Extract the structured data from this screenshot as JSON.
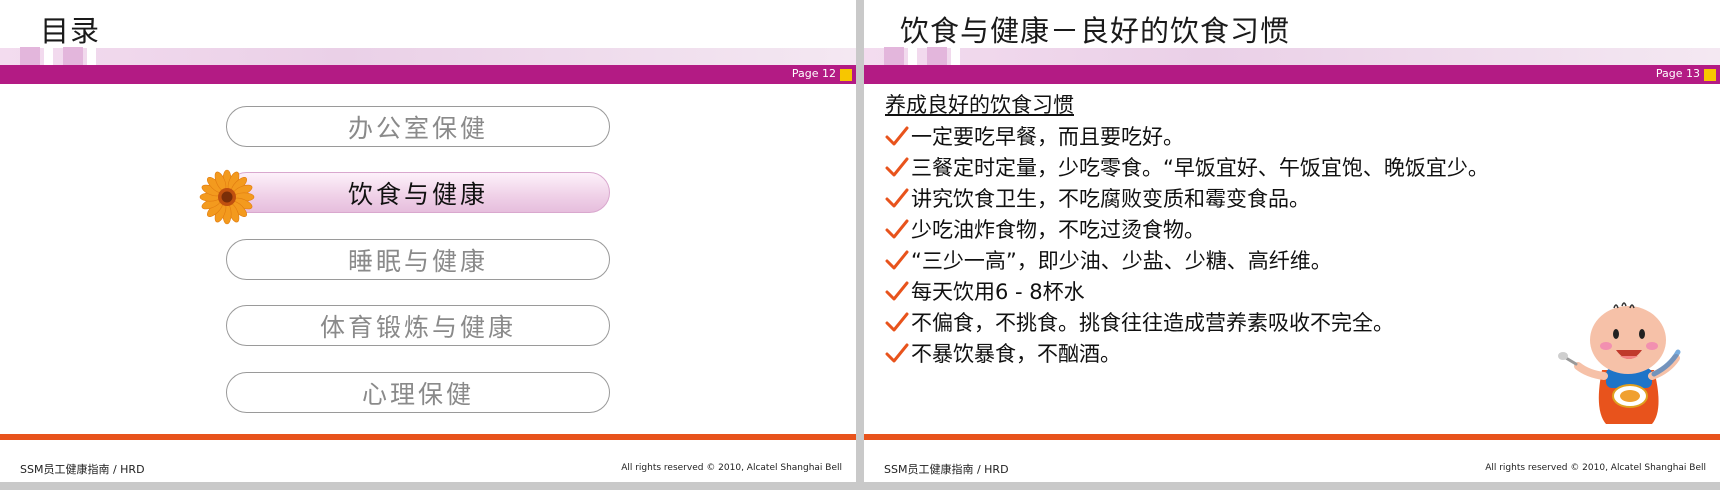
{
  "left_slide": {
    "title": "目录",
    "page": "Page 12",
    "menu": [
      {
        "label": "办公室保健",
        "active": false
      },
      {
        "label": "饮食与健康",
        "active": true
      },
      {
        "label": "睡眠与健康",
        "active": false
      },
      {
        "label": "体育锻炼与健康",
        "active": false
      },
      {
        "label": "心理保健",
        "active": false
      }
    ],
    "footer_left": "SSM员工健康指南  / HRD",
    "footer_right": "All rights reserved © 2010, Alcatel Shanghai Bell"
  },
  "right_slide": {
    "title": "饮食与健康－良好的饮食习惯",
    "page": "Page 13",
    "subheading": "养成良好的饮食习惯",
    "bullets": [
      "一定要吃早餐，而且要吃好。",
      "三餐定时定量，少吃零食。“早饭宜好、午饭宜饱、晚饭宜少。",
      "讲究饮食卫生，不吃腐败变质和霉变食品。",
      "少吃油炸食物，不吃过烫食物。",
      " “三少一高”，即少油、少盐、少糖、高纤维。",
      "每天饮用6 - 8杯水",
      "不偏食，不挑食。挑食往往造成营养素吸收不完全。",
      "不暴饮暴食，不酗酒。"
    ],
    "footer_left": "SSM员工健康指南  / HRD",
    "footer_right": "All rights reserved © 2010, Alcatel Shanghai Bell"
  },
  "icons": [
    "flower-icon",
    "checkmark-icon",
    "cartoon-kid-icon"
  ],
  "colors": {
    "magenta": "#b31b84",
    "orange_line": "#e8531c",
    "accent_yellow": "#f7c600",
    "check": "#e8531c"
  }
}
